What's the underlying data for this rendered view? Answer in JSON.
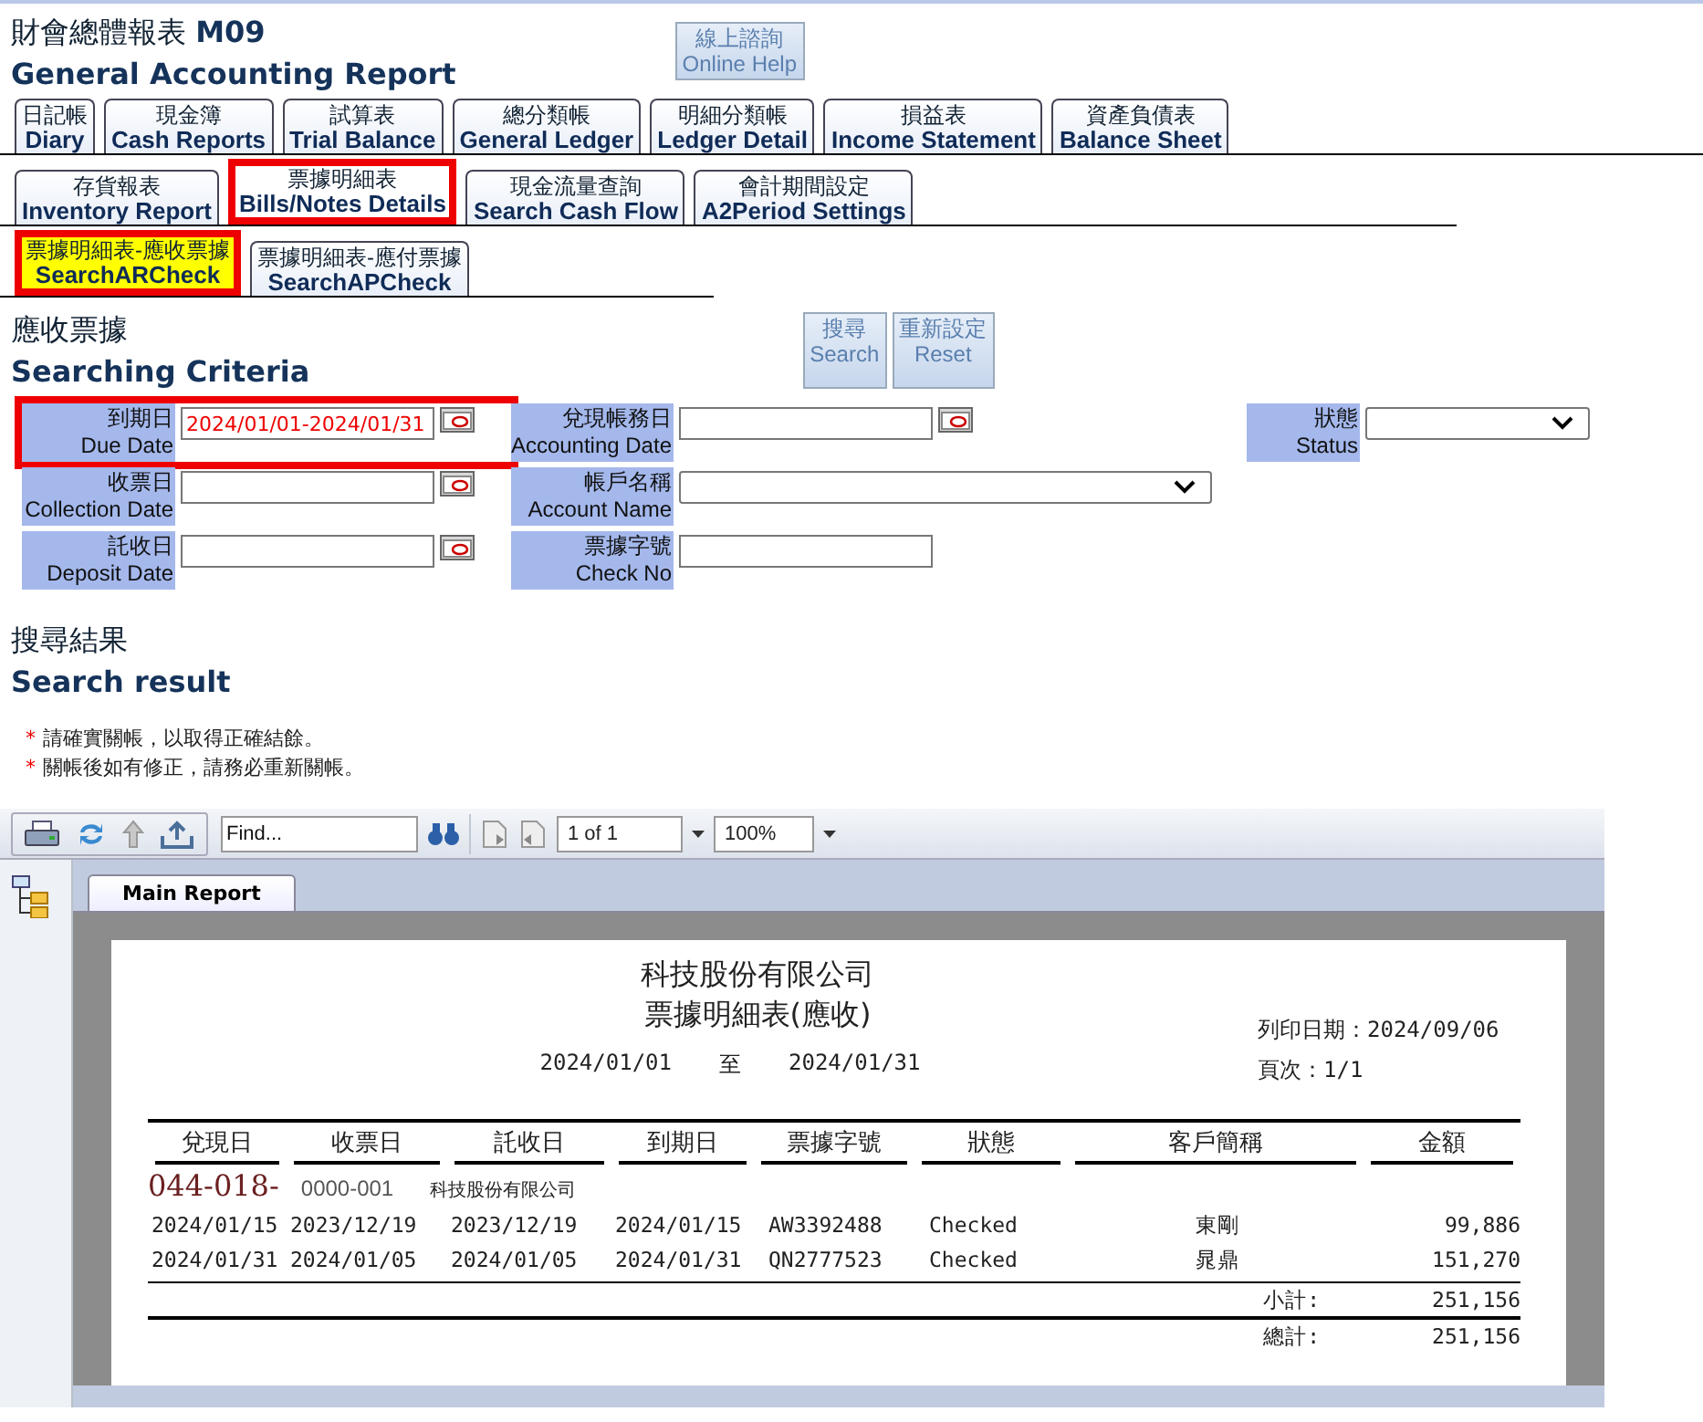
{
  "header": {
    "title_zh": "財會總體報表",
    "code": "M09",
    "title_en": "General Accounting Report",
    "help_button": {
      "zh": "線上諮詢",
      "en": "Online Help"
    }
  },
  "tab_rows": [
    [
      {
        "zh": "日記帳",
        "en": "Diary",
        "selected": false,
        "highlighted": false
      },
      {
        "zh": "現金簿",
        "en": "Cash Reports",
        "selected": false,
        "highlighted": false
      },
      {
        "zh": "試算表",
        "en": "Trial Balance",
        "selected": false,
        "highlighted": false
      },
      {
        "zh": "總分類帳",
        "en": "General Ledger",
        "selected": false,
        "highlighted": false
      },
      {
        "zh": "明細分類帳",
        "en": "Ledger Detail",
        "selected": false,
        "highlighted": false
      },
      {
        "zh": "損益表",
        "en": "Income Statement",
        "selected": false,
        "highlighted": false
      },
      {
        "zh": "資產負債表",
        "en": "Balance Sheet",
        "selected": false,
        "highlighted": false
      }
    ],
    [
      {
        "zh": "存貨報表",
        "en": "Inventory Report",
        "selected": false,
        "highlighted": false
      },
      {
        "zh": "票據明細表",
        "en": "Bills/Notes Details",
        "selected": true,
        "highlighted": true
      },
      {
        "zh": "現金流量查詢",
        "en": "Search Cash Flow",
        "selected": false,
        "highlighted": false
      },
      {
        "zh": "會計期間設定",
        "en": "A2Period Settings",
        "selected": false,
        "highlighted": false
      }
    ],
    [
      {
        "zh": "票據明細表-應收票據",
        "en": "SearchARCheck",
        "selected": true,
        "highlighted": true
      },
      {
        "zh": "票據明細表-應付票據",
        "en": "SearchAPCheck",
        "selected": false,
        "highlighted": false
      }
    ]
  ],
  "criteria": {
    "title_zh": "應收票據",
    "title_en": "Searching Criteria",
    "buttons": [
      {
        "zh": "搜尋",
        "en": "Search"
      },
      {
        "zh": "重新設定",
        "en": "Reset"
      }
    ],
    "rows": [
      [
        {
          "kind": "date",
          "label_zh": "到期日",
          "label_en": "Due Date",
          "value": "2024/01/01-2024/01/31",
          "highlighted": true
        },
        {
          "kind": "date",
          "label_zh": "兌現帳務日",
          "label_en": "Accounting Date",
          "highlighted": false
        },
        {
          "kind": "select",
          "label_zh": "狀態",
          "label_en": "Status",
          "highlighted": false
        }
      ],
      [
        {
          "kind": "date",
          "label_zh": "收票日",
          "label_en": "Collection Date",
          "highlighted": false
        },
        {
          "kind": "wide-select",
          "label_zh": "帳戶名稱",
          "label_en": "Account Name",
          "highlighted": false
        }
      ],
      [
        {
          "kind": "date",
          "label_zh": "託收日",
          "label_en": "Deposit Date",
          "highlighted": false
        },
        {
          "kind": "text",
          "label_zh": "票據字號",
          "label_en": "Check No",
          "highlighted": false
        }
      ]
    ]
  },
  "results": {
    "title_zh": "搜尋結果",
    "title_en": "Search result",
    "notes": [
      {
        "mark": "*",
        "text": "請確實關帳，以取得正確結餘。"
      },
      {
        "mark": "*",
        "text": "關帳後如有修正，請務必重新關帳。"
      }
    ]
  },
  "viewer": {
    "find_placeholder": "Find...",
    "page": "1 of 1",
    "zoom": "100%",
    "tab": "Main Report",
    "report": {
      "company": "科技股份有限公司",
      "title": "票據明細表(應收)",
      "date_from": "2024/01/01",
      "to": "至",
      "date_to": "2024/01/31",
      "print_date": "列印日期：2024/09/06",
      "page": "頁次：1/1",
      "columns": [
        "兌現日",
        "收票日",
        "託收日",
        "到期日",
        "票據字號",
        "狀態",
        "客戶簡稱",
        "金額"
      ],
      "group": {
        "code": "044-018-",
        "sub": "0000-001",
        "name": "科技股份有限公司"
      },
      "rows": [
        [
          "2024/01/15",
          "2023/12/19",
          "2023/12/19",
          "2024/01/15",
          "AW3392488",
          "Checked",
          "東剛",
          "99,886"
        ],
        [
          "2024/01/31",
          "2024/01/05",
          "2024/01/05",
          "2024/01/31",
          "QN2777523",
          "Checked",
          "晁鼎",
          "151,270"
        ]
      ],
      "subtotal_label": "小計:",
      "subtotal": "251,156",
      "total_label": "總計:",
      "total": "251,156"
    }
  }
}
